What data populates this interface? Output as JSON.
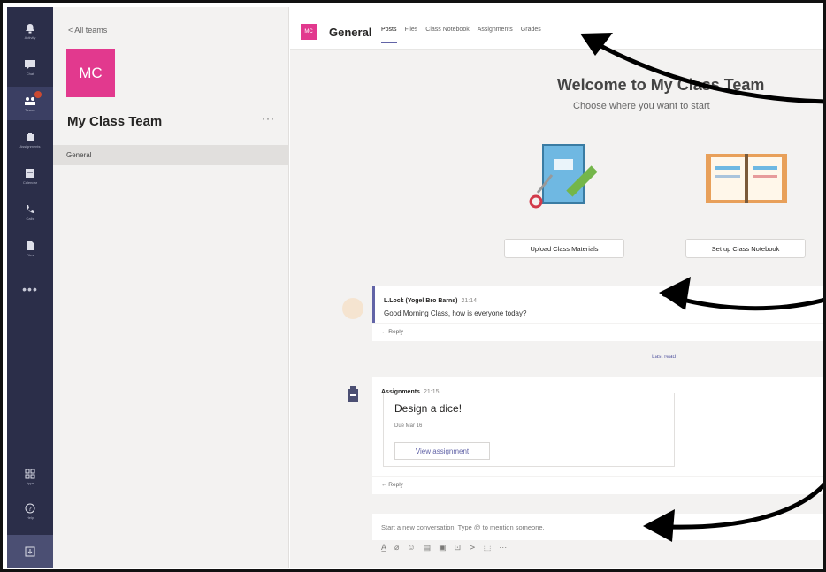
{
  "rail": {
    "items": [
      {
        "icon": "bell-icon",
        "label": "Activity"
      },
      {
        "icon": "chat-icon",
        "label": "Chat"
      },
      {
        "icon": "teams-icon",
        "label": "Teams"
      },
      {
        "icon": "assignments-icon",
        "label": "Assignments"
      },
      {
        "icon": "calendar-icon",
        "label": "Calendar"
      },
      {
        "icon": "calls-icon",
        "label": "Calls"
      },
      {
        "icon": "files-icon",
        "label": "Files"
      }
    ],
    "more": "•••",
    "bottom": [
      {
        "icon": "apps-icon",
        "label": "Apps"
      },
      {
        "icon": "help-icon",
        "label": "Help"
      }
    ]
  },
  "team_panel": {
    "back_label": "< All teams",
    "avatar_initials": "MC",
    "team_name": "My Class Team",
    "more": "···",
    "channel": "General"
  },
  "header": {
    "avatar_initials": "MC",
    "channel_title": "General",
    "tabs": [
      "Posts",
      "Files",
      "Class Notebook",
      "Assignments",
      "Grades"
    ]
  },
  "welcome": {
    "title": "Welcome to My Class Team",
    "subtitle": "Choose where you want to start",
    "upload_button": "Upload Class Materials",
    "notebook_button": "Set up Class Notebook"
  },
  "messages": [
    {
      "author": "L.Lock (Yogel Bro Barns)",
      "time": "21:14",
      "text": "Good Morning Class, how is everyone today?",
      "reply": "← Reply"
    },
    {
      "author": "Assignments",
      "time": "21:15",
      "card_title": "Design a dice!",
      "card_due": "Due Mar 16",
      "card_button": "View assignment",
      "reply": "← Reply"
    }
  ],
  "last_read": "Last read",
  "compose": {
    "placeholder": "Start a new conversation. Type @ to mention someone."
  },
  "toolbar": [
    "format-icon",
    "attach-icon",
    "emoji-icon",
    "giphy-icon",
    "sticker-icon",
    "meet-icon",
    "praise-icon",
    "stream-icon",
    "more-icon"
  ],
  "colors": {
    "rail": "#2b2e49",
    "accent": "#6264a7",
    "avatar": "#e2398e"
  }
}
